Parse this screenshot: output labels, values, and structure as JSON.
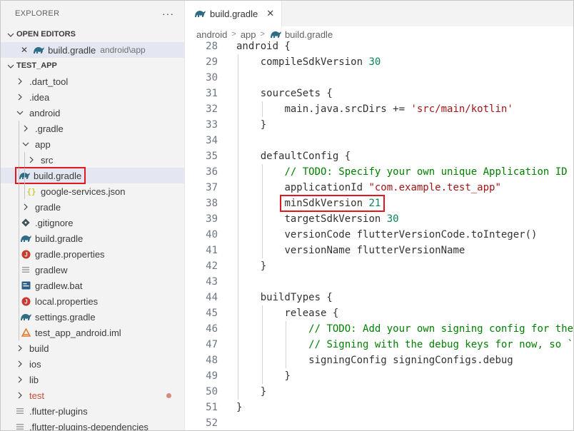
{
  "explorer": {
    "title": "EXPLORER",
    "more": "···",
    "open_editors_label": "OPEN EDITORS",
    "open_editor": {
      "close": "✕",
      "name": "build.gradle",
      "path": "android\\app"
    },
    "project_label": "TEST_APP",
    "tree": [
      {
        "label": ".dart_tool",
        "kind": "folder-closed",
        "indent": 1
      },
      {
        "label": ".idea",
        "kind": "folder-closed",
        "indent": 1
      },
      {
        "label": "android",
        "kind": "folder-open",
        "indent": 1
      },
      {
        "label": ".gradle",
        "kind": "folder-closed",
        "indent": 2
      },
      {
        "label": "app",
        "kind": "folder-open",
        "indent": 2
      },
      {
        "label": "src",
        "kind": "folder-closed",
        "indent": 3
      },
      {
        "label": "build.gradle",
        "kind": "gradle",
        "indent": 3,
        "highlight": true
      },
      {
        "label": "google-services.json",
        "kind": "json",
        "indent": 3
      },
      {
        "label": "gradle",
        "kind": "folder-closed",
        "indent": 2
      },
      {
        "label": ".gitignore",
        "kind": "git",
        "indent": 2
      },
      {
        "label": "build.gradle",
        "kind": "gradle",
        "indent": 2
      },
      {
        "label": "gradle.properties",
        "kind": "props",
        "indent": 2
      },
      {
        "label": "gradlew",
        "kind": "text",
        "indent": 2
      },
      {
        "label": "gradlew.bat",
        "kind": "bat",
        "indent": 2
      },
      {
        "label": "local.properties",
        "kind": "props",
        "indent": 2
      },
      {
        "label": "settings.gradle",
        "kind": "gradle",
        "indent": 2
      },
      {
        "label": "test_app_android.iml",
        "kind": "iml",
        "indent": 2
      },
      {
        "label": "build",
        "kind": "folder-closed",
        "indent": 1
      },
      {
        "label": "ios",
        "kind": "folder-closed",
        "indent": 1
      },
      {
        "label": "lib",
        "kind": "folder-closed",
        "indent": 1
      },
      {
        "label": "test",
        "kind": "folder-closed",
        "indent": 1,
        "modified": true
      },
      {
        "label": ".flutter-plugins",
        "kind": "text",
        "indent": 1
      },
      {
        "label": ".flutter-plugins-dependencies",
        "kind": "text",
        "indent": 1
      }
    ]
  },
  "editor": {
    "tab": {
      "name": "build.gradle",
      "close": "✕"
    },
    "breadcrumb": [
      "android",
      "app",
      "build.gradle"
    ],
    "lines": [
      {
        "n": "28",
        "indent": 0,
        "tokens": [
          [
            "t",
            "android {"
          ]
        ]
      },
      {
        "n": "29",
        "indent": 1,
        "tokens": [
          [
            "t",
            "compileSdkVersion "
          ],
          [
            "num",
            "30"
          ]
        ]
      },
      {
        "n": "30",
        "indent": 0,
        "tokens": []
      },
      {
        "n": "31",
        "indent": 1,
        "tokens": [
          [
            "t",
            "sourceSets {"
          ]
        ]
      },
      {
        "n": "32",
        "indent": 2,
        "tokens": [
          [
            "t",
            "main.java.srcDirs += "
          ],
          [
            "str",
            "'src/main/kotlin'"
          ]
        ]
      },
      {
        "n": "33",
        "indent": 1,
        "tokens": [
          [
            "t",
            "}"
          ]
        ]
      },
      {
        "n": "34",
        "indent": 0,
        "tokens": []
      },
      {
        "n": "35",
        "indent": 1,
        "tokens": [
          [
            "t",
            "defaultConfig {"
          ]
        ]
      },
      {
        "n": "36",
        "indent": 2,
        "tokens": [
          [
            "cmt",
            "// TODO: Specify your own unique Application ID (ht"
          ]
        ]
      },
      {
        "n": "37",
        "indent": 2,
        "tokens": [
          [
            "t",
            "applicationId "
          ],
          [
            "str",
            "\"com.example.test_app\""
          ]
        ]
      },
      {
        "n": "38",
        "indent": 2,
        "tokens": [
          [
            "t",
            "minSdkVersion "
          ],
          [
            "num",
            "21"
          ]
        ],
        "highlight": true
      },
      {
        "n": "39",
        "indent": 2,
        "tokens": [
          [
            "t",
            "targetSdkVersion "
          ],
          [
            "num",
            "30"
          ]
        ]
      },
      {
        "n": "40",
        "indent": 2,
        "tokens": [
          [
            "t",
            "versionCode flutterVersionCode.toInteger()"
          ]
        ]
      },
      {
        "n": "41",
        "indent": 2,
        "tokens": [
          [
            "t",
            "versionName flutterVersionName"
          ]
        ]
      },
      {
        "n": "42",
        "indent": 1,
        "tokens": [
          [
            "t",
            "}"
          ]
        ]
      },
      {
        "n": "43",
        "indent": 0,
        "tokens": []
      },
      {
        "n": "44",
        "indent": 1,
        "tokens": [
          [
            "t",
            "buildTypes {"
          ]
        ]
      },
      {
        "n": "45",
        "indent": 2,
        "tokens": [
          [
            "t",
            "release {"
          ]
        ]
      },
      {
        "n": "46",
        "indent": 3,
        "tokens": [
          [
            "cmt",
            "// TODO: Add your own signing config for the re"
          ]
        ]
      },
      {
        "n": "47",
        "indent": 3,
        "tokens": [
          [
            "cmt",
            "// Signing with the debug keys for now, so `flu"
          ]
        ]
      },
      {
        "n": "48",
        "indent": 3,
        "tokens": [
          [
            "t",
            "signingConfig signingConfigs.debug"
          ]
        ]
      },
      {
        "n": "49",
        "indent": 2,
        "tokens": [
          [
            "t",
            "}"
          ]
        ]
      },
      {
        "n": "50",
        "indent": 1,
        "tokens": [
          [
            "t",
            "}"
          ]
        ]
      },
      {
        "n": "51",
        "indent": 0,
        "tokens": [
          [
            "t",
            "}"
          ]
        ]
      },
      {
        "n": "52",
        "indent": 0,
        "tokens": []
      }
    ]
  },
  "colors": {
    "highlight_box": "#e0191f",
    "gradle_icon": "#02303a",
    "comment": "#008000",
    "string": "#a31515",
    "number": "#098658"
  }
}
